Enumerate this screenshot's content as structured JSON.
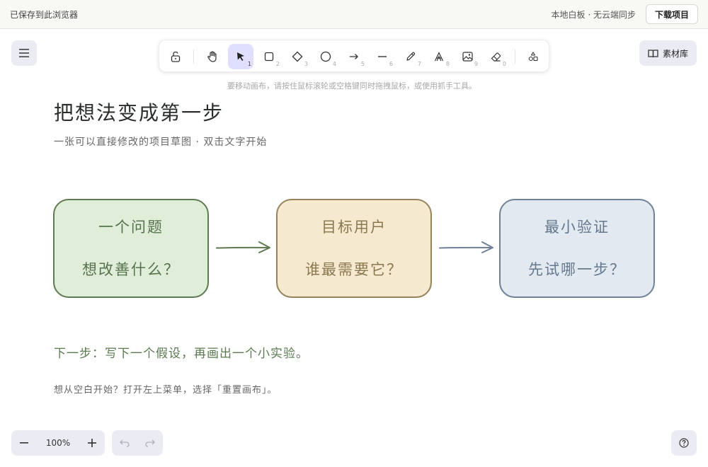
{
  "topbar": {
    "saved": "已保存到此浏览器",
    "status": "本地白板 · 无云端同步",
    "download": "下载项目"
  },
  "library": {
    "label": "素材库"
  },
  "toolbar": {
    "tools": [
      {
        "name": "lock",
        "icon": "lock-icon",
        "key": ""
      },
      {
        "name": "hand",
        "icon": "hand-icon",
        "key": ""
      },
      {
        "name": "select",
        "icon": "pointer-icon",
        "key": "1",
        "active": true
      },
      {
        "name": "rectangle",
        "icon": "rectangle-icon",
        "key": "2"
      },
      {
        "name": "diamond",
        "icon": "diamond-icon",
        "key": "3"
      },
      {
        "name": "ellipse",
        "icon": "ellipse-icon",
        "key": "4"
      },
      {
        "name": "arrow",
        "icon": "arrow-icon",
        "key": "5"
      },
      {
        "name": "line",
        "icon": "line-icon",
        "key": "6"
      },
      {
        "name": "draw",
        "icon": "pencil-icon",
        "key": "7"
      },
      {
        "name": "text",
        "icon": "text-icon",
        "key": "8"
      },
      {
        "name": "image",
        "icon": "image-icon",
        "key": "9"
      },
      {
        "name": "eraser",
        "icon": "eraser-icon",
        "key": "0"
      },
      {
        "name": "more-shapes",
        "icon": "shapes-icon",
        "key": ""
      }
    ]
  },
  "hint": "要移动画布，请按住鼠标滚轮或空格键同时拖拽鼠标，或使用抓手工具。",
  "canvas": {
    "title": "把想法变成第一步",
    "subtitle": "一张可以直接修改的项目草图 · 双击文字开始",
    "cards": [
      {
        "title": "一个问题",
        "body": "想改善什么？"
      },
      {
        "title": "目标用户",
        "body": "谁最需要它？"
      },
      {
        "title": "最小验证",
        "body": "先试哪一步？"
      }
    ],
    "next_step": "下一步：写下一个假设，再画出一个小实验。",
    "reset_hint": "想从空白开始？打开左上菜单，选择「重置画布」。"
  },
  "zoom": {
    "value": "100%"
  },
  "colors": {
    "accent": "#e0dfff",
    "green": "#56724c",
    "yellow": "#8c7850",
    "blue": "#66788c"
  }
}
